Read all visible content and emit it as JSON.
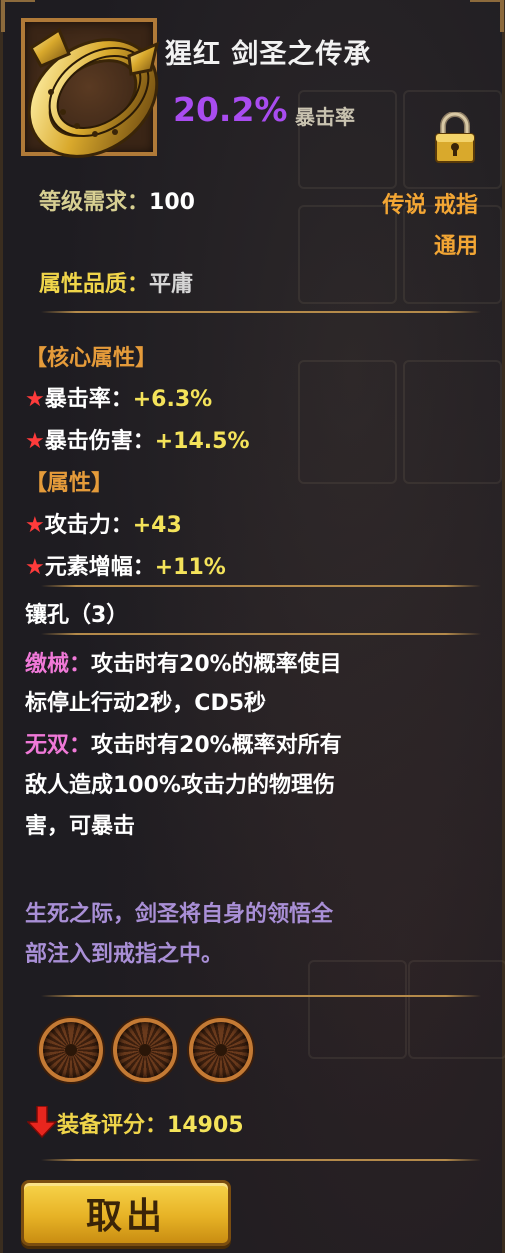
{
  "item": {
    "name": "猩红 剑圣之传承",
    "crit_value": "20.2%",
    "crit_label": "暴击率",
    "level_label": "等级需求：",
    "level_value": "100",
    "rarity_type": "传说 戒指",
    "usage": "通用",
    "quality_label": "属性品质：",
    "quality_value": "平庸"
  },
  "core": {
    "header": "【核心属性】",
    "stats": [
      {
        "name": "暴击率：",
        "value": "+6.3%"
      },
      {
        "name": "暴击伤害：",
        "value": "+14.5%"
      }
    ]
  },
  "attrs": {
    "header": "【属性】",
    "stats": [
      {
        "name": "攻击力：",
        "value": "+43"
      },
      {
        "name": "元素增幅：",
        "value": "+11%"
      }
    ]
  },
  "sockets": {
    "label": "镶孔（3）",
    "count": 3
  },
  "affixes": [
    {
      "name": "缴械：",
      "line1": "攻击时有20%的概率使目",
      "line2": "标停止行动2秒，CD5秒"
    },
    {
      "name": "无双：",
      "line1": "攻击时有20%概率对所有",
      "line2": "敌人造成100%攻击力的物理伤",
      "line3": "害，可暴击"
    }
  ],
  "lore": {
    "line1": "生死之际，剑圣将自身的领悟全",
    "line2": "部注入到戒指之中。"
  },
  "score": {
    "label": "装备评分：",
    "value": "14905"
  },
  "button": {
    "takeout": "取出"
  },
  "icons": [
    "ring-icon",
    "lock-icon",
    "star-icon",
    "down-arrow-icon",
    "socket-icon"
  ],
  "colors": {
    "crit_purple": "#a94cf0",
    "legend_orange": "#f3a634",
    "stat_yellow": "#f4e35a",
    "star_red": "#ff3b3b",
    "affix_pink": "#f079d8",
    "lore_purple": "#a98fd6"
  }
}
